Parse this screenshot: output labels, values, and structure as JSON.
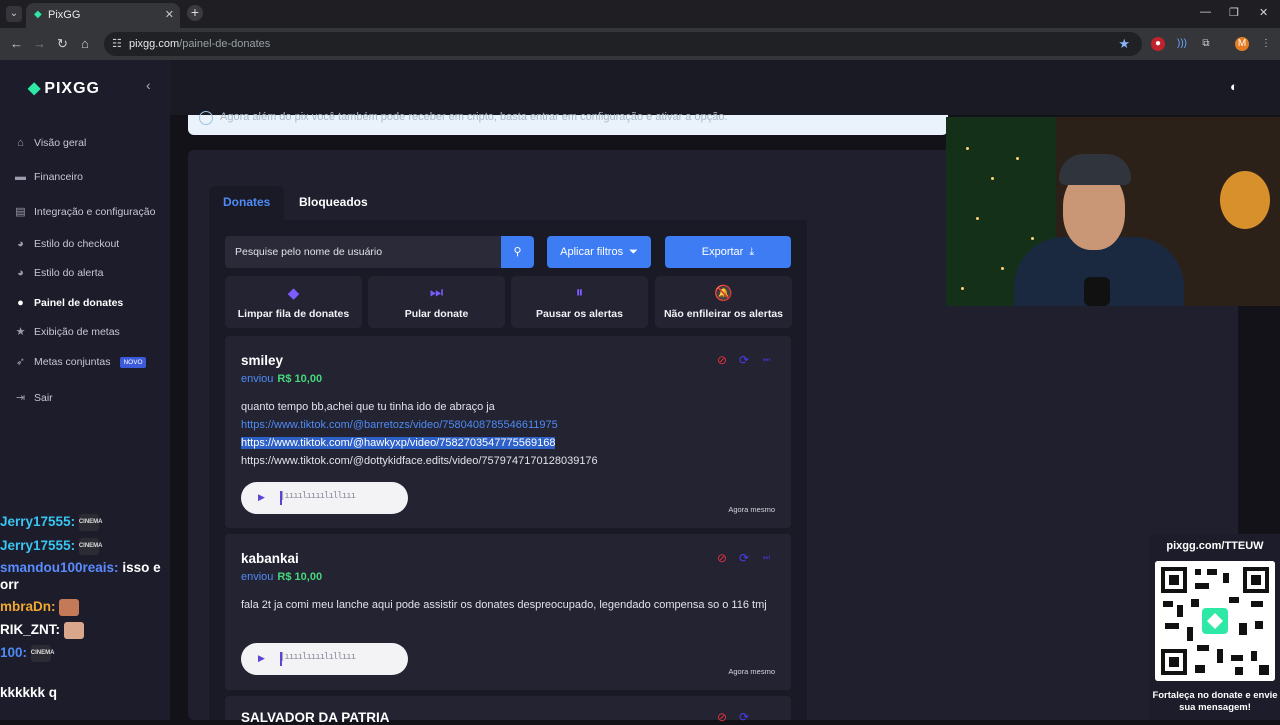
{
  "browser": {
    "tab_title": "PixGG",
    "url_host": "pixgg.com",
    "url_path": "/painel-de-donates",
    "profile_initial": "M"
  },
  "sidebar": {
    "logo": "PIXGG",
    "items": [
      {
        "label": "Visão geral",
        "icon": "home-icon"
      },
      {
        "label": "Financeiro",
        "icon": "wallet-icon"
      },
      {
        "label": "Integração e configuração",
        "icon": "document-icon"
      },
      {
        "label": "Estilo do checkout",
        "icon": "palette-icon"
      },
      {
        "label": "Estilo do alerta",
        "icon": "palette-icon"
      },
      {
        "label": "Painel de donates",
        "icon": "user-icon"
      },
      {
        "label": "Exibição de metas",
        "icon": "star-icon"
      },
      {
        "label": "Metas conjuntas",
        "icon": "rocket-icon",
        "badge": "NOVO"
      },
      {
        "label": "Sair",
        "icon": "logout-icon"
      }
    ]
  },
  "chat": [
    {
      "user": "Jerry17555:",
      "text": "",
      "emote": "CINEMA",
      "color": "#38c6f2"
    },
    {
      "user": "Jerry17555:",
      "text": "",
      "emote": "CINEMA",
      "color": "#38c6f2"
    },
    {
      "user": "smandou100reais:",
      "text": "isso e",
      "color": "#5a8cff"
    },
    {
      "user": "",
      "text": "orr",
      "color": "#ffffff"
    },
    {
      "user": "mbraDn:",
      "text": "",
      "emote": "face",
      "color": "#f0a830"
    },
    {
      "user": "RIK_ZNT:",
      "text": "",
      "emote": "hand",
      "color": "#ffffff"
    },
    {
      "user": "100:",
      "text": "",
      "emote": "CINEMA",
      "color": "#4e8bf5"
    },
    {
      "user": "",
      "text": "kkkkkk q",
      "color": "#ffffff"
    }
  ],
  "banner": {
    "text": "Agora além do pix você também pode receber em cripto, basta entrar em configuração e ativar a opção."
  },
  "tabs": [
    "Donates",
    "Bloqueados"
  ],
  "search": {
    "placeholder": "Pesquise pelo nome de usuário"
  },
  "buttons": {
    "filters": "Aplicar filtros",
    "export": "Exportar"
  },
  "actions": [
    {
      "label": "Limpar fila de donates",
      "icon": "eraser-icon"
    },
    {
      "label": "Pular donate",
      "icon": "skip-icon"
    },
    {
      "label": "Pausar os alertas",
      "icon": "pause-icon"
    },
    {
      "label": "Não enfileirar os alertas",
      "icon": "bell-off-icon"
    }
  ],
  "donates": [
    {
      "name": "smiley",
      "sent_label": "enviou",
      "amount": "R$ 10,00",
      "message": "quanto tempo bb,achei que tu tinha ido de abraço ja",
      "links": [
        "https://www.tiktok.com/@barretozs/video/7580408785546611975",
        "https://www.tiktok.com/@hawkyxp/video/7582703547775569168",
        "https://www.tiktok.com/@dottykidface.edits/video/7579747170128039176"
      ],
      "time": "Agora mesmo"
    },
    {
      "name": "kabankai",
      "sent_label": "enviou",
      "amount": "R$ 10,00",
      "message": "fala 2t ja comi meu lanche aqui pode assistir os donates despreocupado, legendado compensa so o 116 tmj",
      "time": "Agora mesmo"
    },
    {
      "name": "SALVADOR DA PATRIA"
    }
  ],
  "qr": {
    "url": "pixgg.com/TTEUW",
    "caption": "Fortaleça no donate e envie sua mensagem!"
  }
}
